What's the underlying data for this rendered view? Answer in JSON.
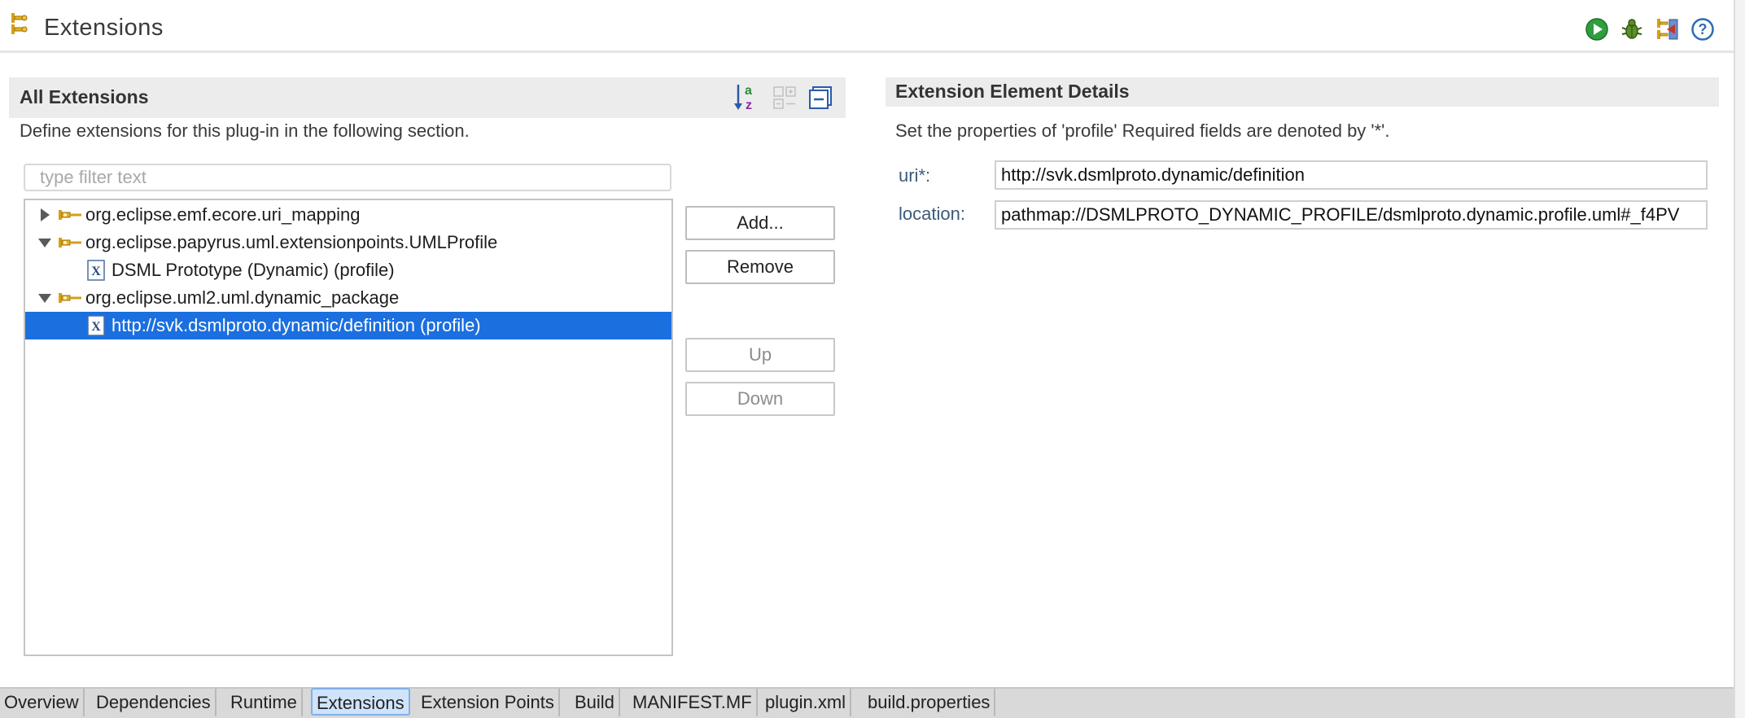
{
  "page": {
    "title": "Extensions"
  },
  "toolbar": {
    "icons": [
      "run-icon",
      "debug-icon",
      "export-icon",
      "help-icon"
    ]
  },
  "all_extensions": {
    "title": "All Extensions",
    "description": "Define extensions for this plug-in in the following section.",
    "filter_placeholder": "type filter text",
    "filter_value": "",
    "toolbar_icons": [
      "sort-alphabetical-icon",
      "expand-all-icon",
      "collapse-all-icon"
    ],
    "tree": [
      {
        "label": "org.eclipse.emf.ecore.uri_mapping",
        "level": 0,
        "expanded": false,
        "type": "extension",
        "selected": false
      },
      {
        "label": "org.eclipse.papyrus.uml.extensionpoints.UMLProfile",
        "level": 0,
        "expanded": true,
        "type": "extension",
        "selected": false
      },
      {
        "label": "DSML Prototype (Dynamic) (profile)",
        "level": 1,
        "type": "element",
        "selected": false
      },
      {
        "label": "org.eclipse.uml2.uml.dynamic_package",
        "level": 0,
        "expanded": true,
        "type": "extension",
        "selected": false
      },
      {
        "label": "http://svk.dsmlproto.dynamic/definition (profile)",
        "level": 1,
        "type": "element",
        "selected": true
      }
    ],
    "buttons": {
      "add": "Add...",
      "remove": "Remove",
      "up": "Up",
      "down": "Down"
    }
  },
  "details": {
    "title": "Extension Element Details",
    "description": "Set the properties of 'profile' Required fields are denoted by '*'.",
    "fields": [
      {
        "label": "uri*:",
        "value": "http://svk.dsmlproto.dynamic/definition"
      },
      {
        "label": "location:",
        "value": "pathmap://DSMLPROTO_DYNAMIC_PROFILE/dsmlproto.dynamic.profile.uml#_f4PV"
      }
    ]
  },
  "tabs": [
    {
      "label": "Overview",
      "active": false
    },
    {
      "label": "Dependencies",
      "active": false
    },
    {
      "label": "Runtime",
      "active": false
    },
    {
      "label": "Extensions",
      "active": true
    },
    {
      "label": "Extension Points",
      "active": false
    },
    {
      "label": "Build",
      "active": false
    },
    {
      "label": "MANIFEST.MF",
      "active": false
    },
    {
      "label": "plugin.xml",
      "active": false
    },
    {
      "label": "build.properties",
      "active": false
    }
  ],
  "colors": {
    "selection": "#1b6fdf",
    "active_tab": "#cfe3fb",
    "section_header": "#ececec"
  }
}
